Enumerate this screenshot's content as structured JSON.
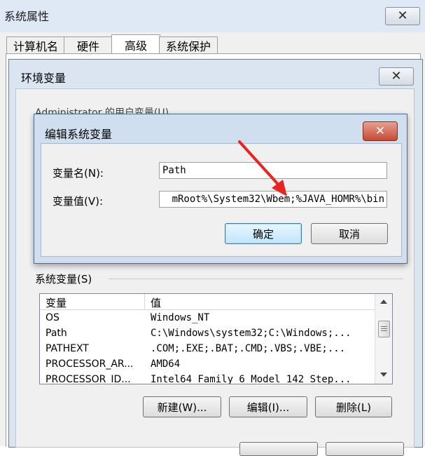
{
  "outer_window": {
    "title": "系统属性"
  },
  "tabs": [
    {
      "label": "计算机名"
    },
    {
      "label": "硬件"
    },
    {
      "label": "高级"
    },
    {
      "label": "系统保护"
    }
  ],
  "env_dialog": {
    "title": "环境变量",
    "user_vars_label": "Administrator 的用户变量(U)"
  },
  "edit_dialog": {
    "title": "编辑系统变量",
    "name_label": "变量名(N):",
    "name_value": "Path",
    "value_label": "变量值(V):",
    "value_value": "mRoot%\\System32\\Wbem;%JAVA_HOMR%\\bin",
    "ok_label": "确定",
    "cancel_label": "取消"
  },
  "system_vars": {
    "label": "系统变量(S)",
    "col_var": "变量",
    "col_val": "值",
    "rows": [
      {
        "name": "OS",
        "value": "Windows_NT"
      },
      {
        "name": "Path",
        "value": "C:\\Windows\\system32;C:\\Windows;..."
      },
      {
        "name": "PATHEXT",
        "value": ".COM;.EXE;.BAT;.CMD;.VBS;.VBE;..."
      },
      {
        "name": "PROCESSOR_AR...",
        "value": "AMD64"
      },
      {
        "name": "PROCESSOR_ID...",
        "value": "Intel64 Family 6 Model 142 Step..."
      }
    ],
    "new_label": "新建(W)...",
    "edit_label": "编辑(I)...",
    "delete_label": "删除(L)"
  },
  "colors": {
    "arrow": "#e8241f",
    "selected_row": "#ffffff"
  }
}
